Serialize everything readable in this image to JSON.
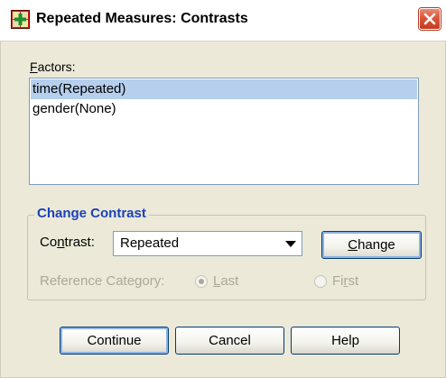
{
  "window": {
    "title": "Repeated Measures: Contrasts",
    "app_icon": "spss-plus-icon",
    "close_icon": "close-x-icon"
  },
  "factors": {
    "label_accel": "F",
    "label_rest": "actors:",
    "items": [
      "time(Repeated)",
      "gender(None)"
    ],
    "selected_index": 0
  },
  "change_contrast": {
    "group_title": "Change Contrast",
    "contrast_label_pre": "Co",
    "contrast_label_accel": "n",
    "contrast_label_post": "trast:",
    "contrast_value": "Repeated",
    "change_button_accel": "C",
    "change_button_rest": "hange",
    "reference_label": "Reference Category:",
    "radio_last_accel": "L",
    "radio_last_rest": "ast",
    "radio_first_pre": "Fi",
    "radio_first_accel": "r",
    "radio_first_post": "st",
    "reference_selected": "Last",
    "reference_enabled": false
  },
  "buttons": {
    "continue": "Continue",
    "cancel": "Cancel",
    "help": "Help"
  },
  "colors": {
    "dialog_bg": "#ECE9D8",
    "selection": "#B6CFED",
    "group_title": "#1A43B5",
    "disabled_text": "#ACA899",
    "close_button": "#D9563A"
  }
}
